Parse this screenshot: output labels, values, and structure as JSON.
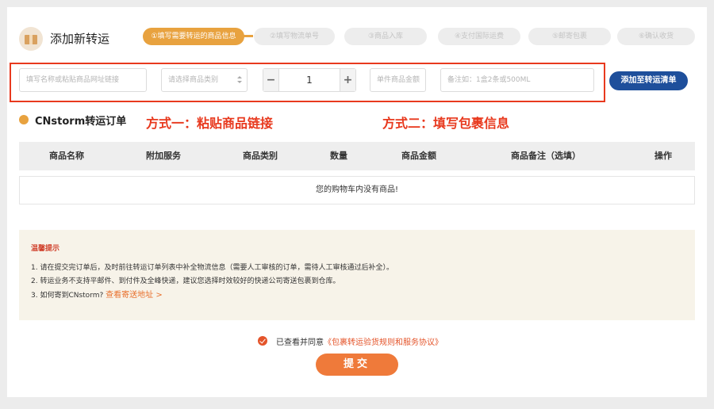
{
  "header": {
    "title": "添加新转运",
    "avatar_icon": "package-icon"
  },
  "steps": [
    {
      "label": "①填写需要转运的商品信息",
      "active": true
    },
    {
      "label": "②填写物流单号",
      "active": false
    },
    {
      "label": "③商品入库",
      "active": false
    },
    {
      "label": "④支付国际运费",
      "active": false
    },
    {
      "label": "⑤邮寄包裹",
      "active": false
    },
    {
      "label": "⑥确认收货",
      "active": false
    }
  ],
  "form": {
    "link_placeholder": "填写名称或粘贴商品网址链接",
    "category_placeholder": "请选择商品类别",
    "quantity": "1",
    "minus_label": "−",
    "plus_label": "+",
    "price_placeholder": "单件商品金额",
    "note_placeholder": "备注如：1盒2条或500ML",
    "add_button": "添加至转运清单"
  },
  "order": {
    "title": "CNstorm转运订单",
    "method_one": "方式一：粘贴商品链接",
    "method_two": "方式二：填写包裹信息"
  },
  "table": {
    "headers": [
      "商品名称",
      "附加服务",
      "商品类别",
      "数量",
      "商品金额",
      "商品备注（选填）",
      "操作"
    ],
    "empty_message": "您的购物车内没有商品!"
  },
  "tips": {
    "title": "温馨提示",
    "items": [
      "1. 请在提交完订单后，及时前往转运订单列表中补全物流信息（需要人工审核的订单，需待人工审核通过后补全）。",
      "2. 转运业务不支持平邮件、到付件及全峰快递，建议您选择时效较好的快递公司寄送包裹到仓库。",
      "3. 如何寄到CNstorm?"
    ],
    "link": "查看寄送地址 >"
  },
  "agreement": {
    "text": "已查看并同意",
    "link": "《包裹转运验货规则和服务协议》"
  },
  "submit": {
    "label": "提交"
  },
  "colors": {
    "accent_orange": "#e8a23f",
    "primary_blue": "#1e4f9b",
    "annotation_red": "#e8391e",
    "submit_orange": "#ef7a3a"
  }
}
